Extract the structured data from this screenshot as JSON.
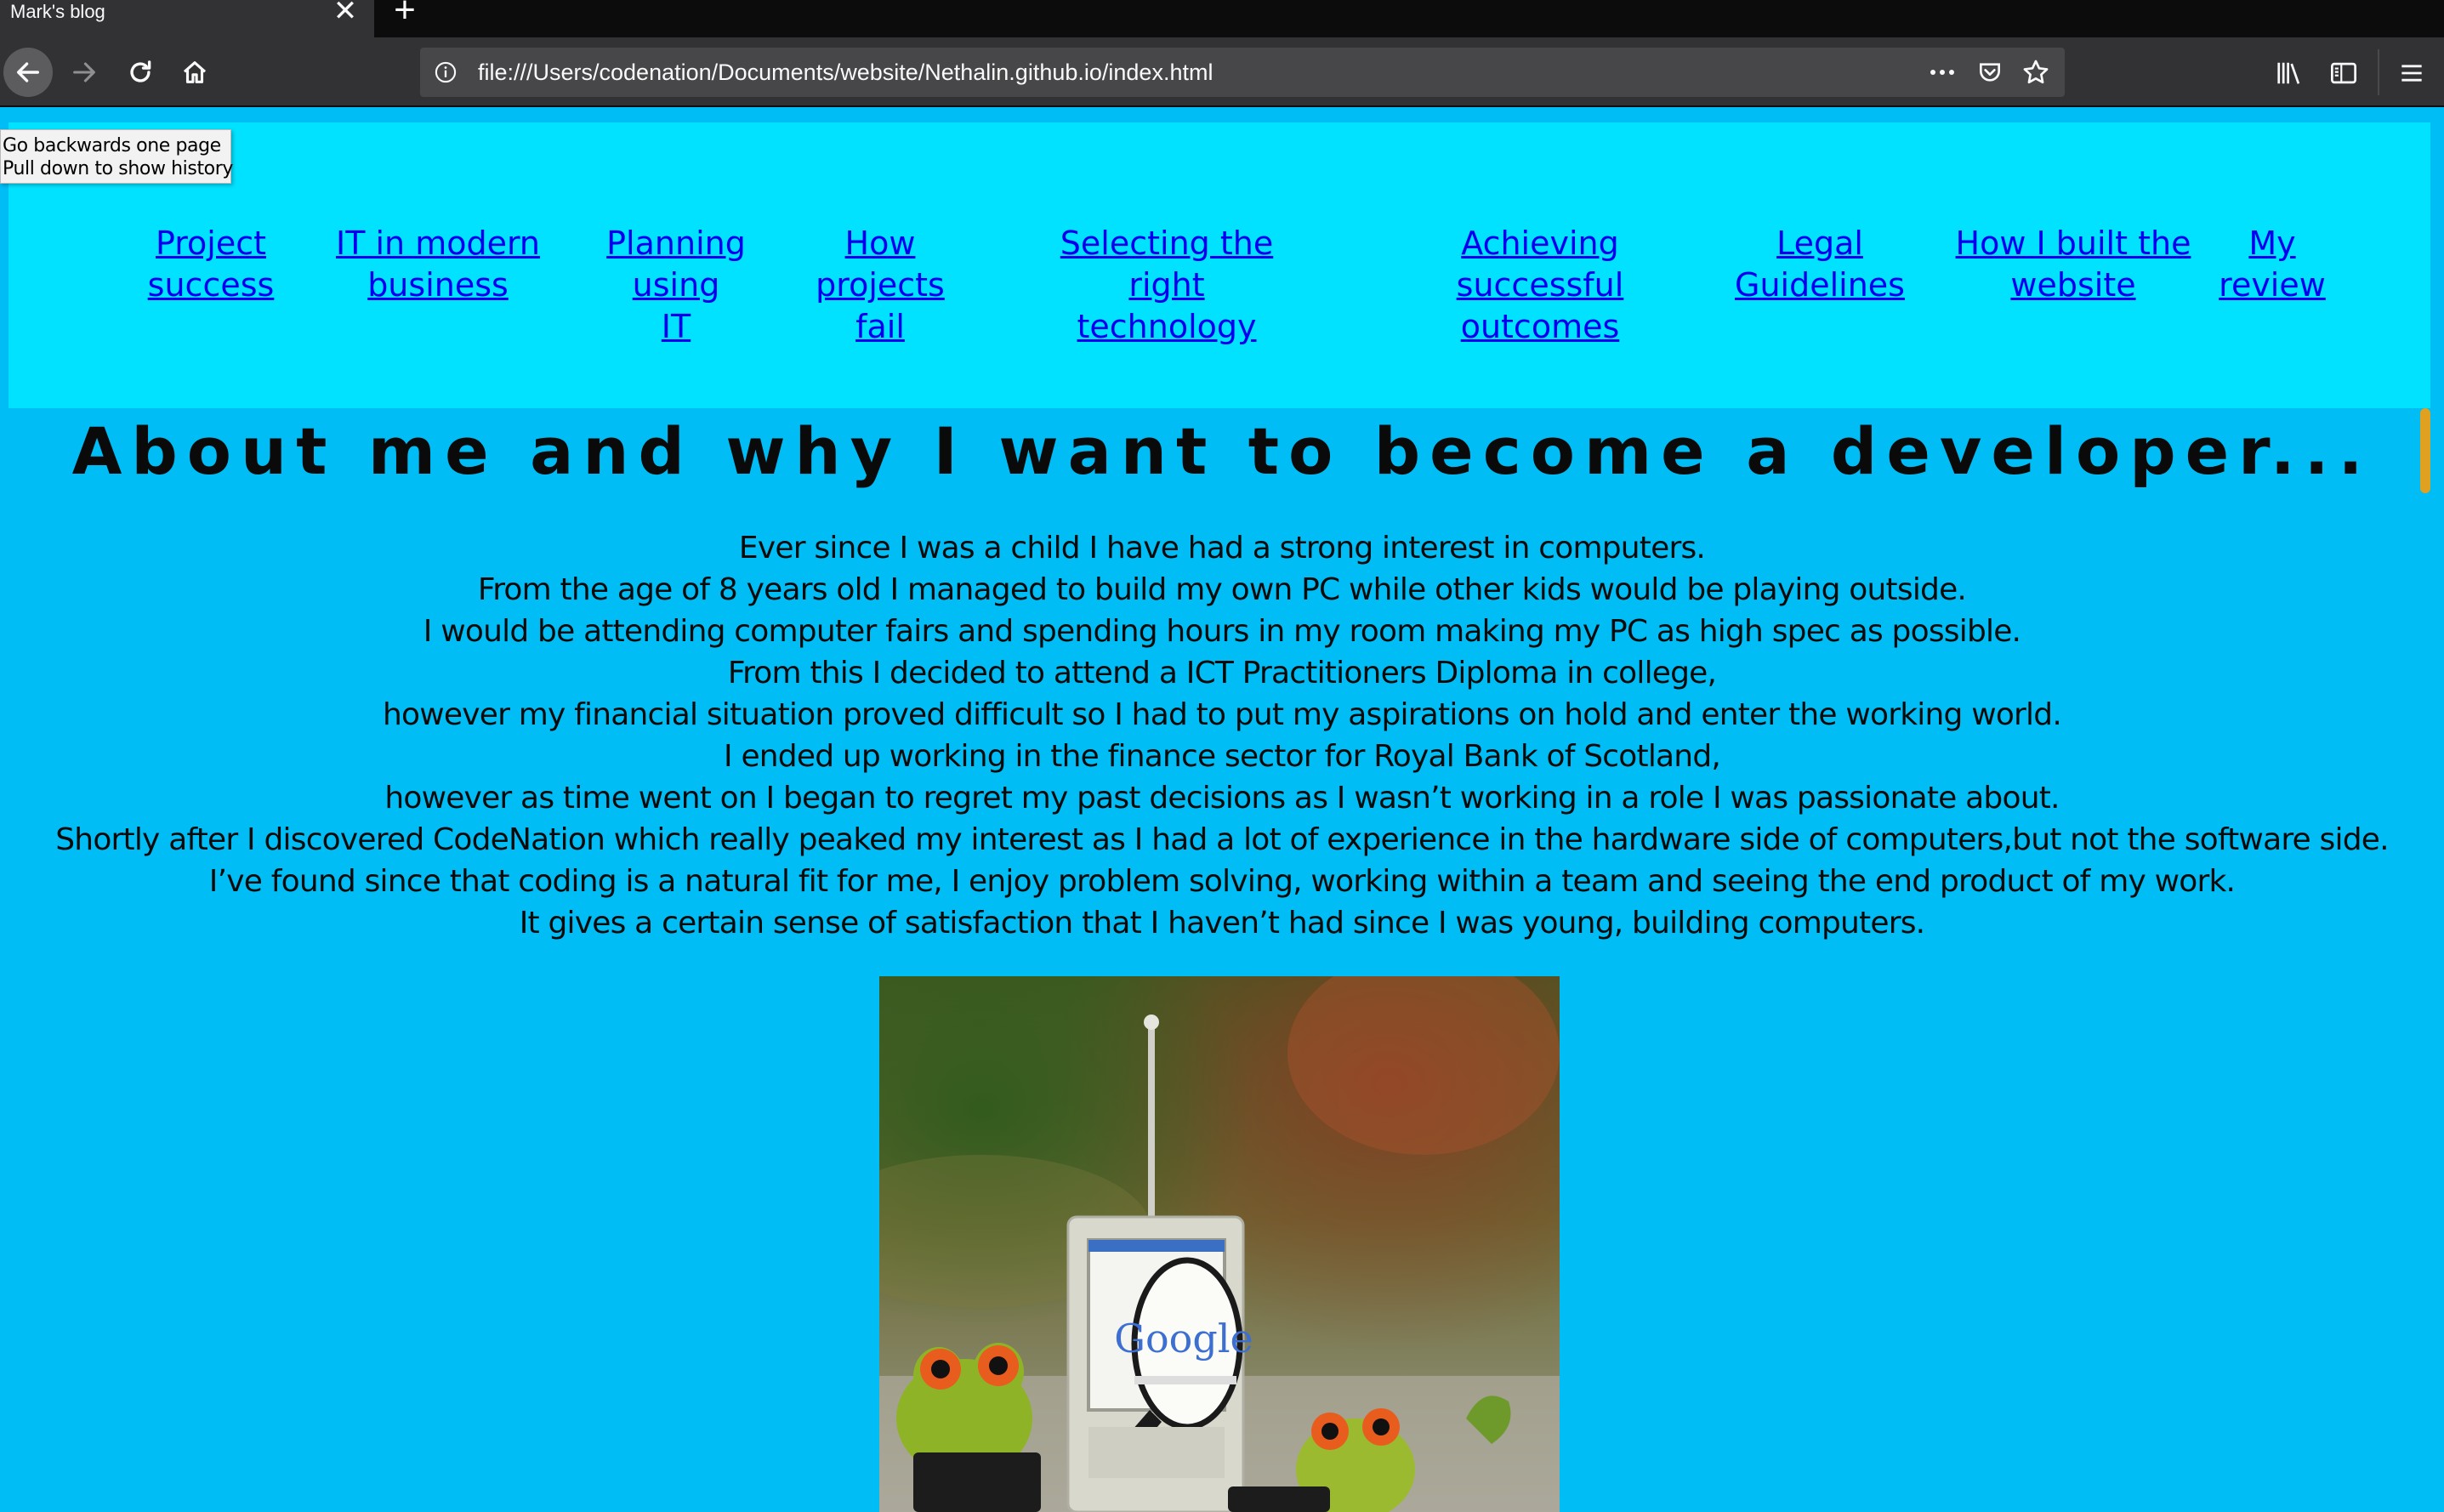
{
  "browser": {
    "tab_title": "Mark's blog",
    "tab_close_glyph": "✕",
    "new_tab_glyph": "+",
    "url": "file:///Users/codenation/Documents/website/Nethalin.github.io/index.html",
    "tooltip": [
      "Go backwards one page",
      "Pull down to show history"
    ],
    "icons": [
      "back-arrow-icon",
      "forward-arrow-icon",
      "reload-icon",
      "home-icon",
      "info-icon",
      "more-dots-icon",
      "pocket-icon",
      "star-icon",
      "library-icon",
      "sidebar-icon",
      "hamburger-menu-icon"
    ]
  },
  "nav": {
    "links": [
      [
        "Project",
        "success"
      ],
      [
        "IT in modern",
        "business"
      ],
      [
        "Planning using",
        "IT"
      ],
      [
        "How projects",
        "fail"
      ],
      [
        "Selecting the right",
        "technology"
      ],
      [
        "Achieving successful",
        "outcomes"
      ],
      [
        "Legal",
        "Guidelines"
      ],
      [
        "How I built the",
        "website"
      ],
      [
        "My",
        "review"
      ]
    ]
  },
  "main": {
    "heading": "About me and why I want to become a developer...",
    "paragraph": [
      "Ever since I was a child I have had a strong interest in computers.",
      "From the age of 8 years old I managed to build my own PC while other kids would be playing outside.",
      "I would be attending computer fairs and spending hours in my room making my PC as high spec as possible.",
      "From this I decided to attend a ICT Practitioners Diploma in college,",
      "however my financial situation proved difficult so I had to put my aspirations on hold and enter the working world.",
      "I ended up working in the finance sector for Royal Bank of Scotland,",
      "however as time went on I began to regret my past decisions as I wasn’t working in a role I was passionate about.",
      "Shortly after I discovered CodeNation which really peaked my interest as I had a lot of experience in the hardware side of computers,but not the software side.",
      "I’ve found since that coding is a natural fit for me, I enjoy problem solving, working within a team and seeing the end product of my work.",
      "It gives a certain sense of satisfaction that I haven’t had since I was young, building computers."
    ],
    "image_logo_text": "Google"
  },
  "colors": {
    "page_bg": "#00bdf5",
    "nav_bg": "#00e2ff",
    "link": "#0000ee",
    "chrome_dark": "#0c0c0d",
    "chrome_toolbar": "#323234"
  }
}
